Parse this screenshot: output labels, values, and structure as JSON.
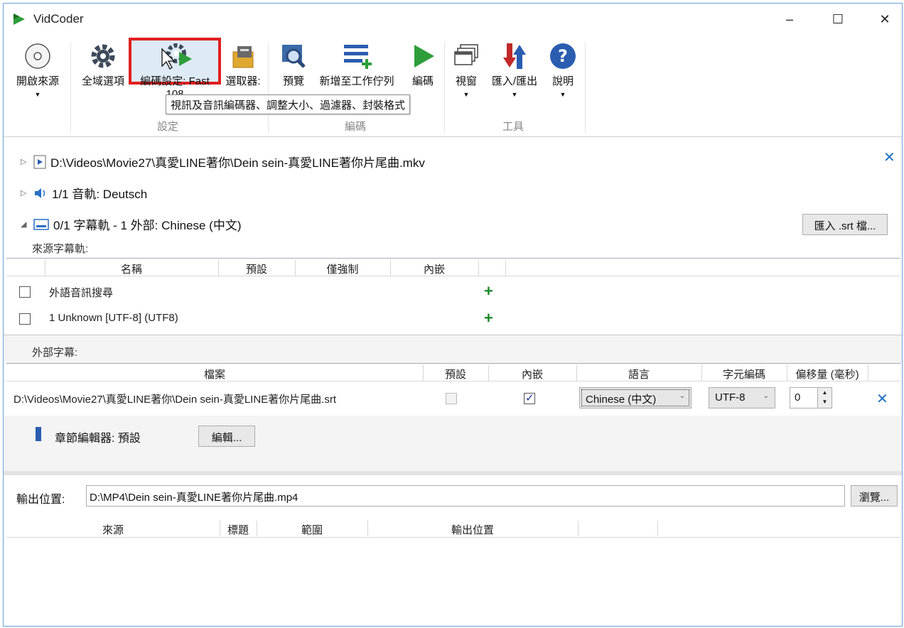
{
  "window": {
    "title": "VidCoder",
    "minimize": "–",
    "maximize": "☐",
    "close": "✕"
  },
  "ribbon": {
    "open_source": "開啟來源",
    "global_options": "全域選項",
    "encode_settings": "編碼設定: Fast",
    "encode_settings_line2": "108",
    "picker": "選取器:",
    "preview": "預覽",
    "add_queue": "新增至工作佇列",
    "encode": "編碼",
    "window": "視窗",
    "import_export": "匯入/匯出",
    "help": "說明",
    "group_settings": "設定",
    "group_encode": "編碼",
    "group_tools": "工具",
    "tooltip": "視訊及音訊編碼器、調整大小、過濾器、封裝格式",
    "dropdown_arrow": "▼"
  },
  "source": {
    "file_path": "D:\\Videos\\Movie27\\真愛LINE著你\\Dein sein-真愛LINE著你片尾曲.mkv",
    "audio": "1/1 音軌: Deutsch",
    "subtitles": "0/1 字幕軌 - 1 外部: Chinese (中文)",
    "import_srt": "匯入 .srt 檔...",
    "remove": "✕"
  },
  "source_subtitles": {
    "label": "來源字幕軌:",
    "headers": [
      "名稱",
      "預設",
      "僅強制",
      "內嵌"
    ],
    "rows": [
      {
        "name": "外語音訊搜尋",
        "add": "+"
      },
      {
        "name": "1 Unknown [UTF-8] (UTF8)",
        "add": "+"
      }
    ]
  },
  "external_subtitles": {
    "label": "外部字幕:",
    "headers": [
      "檔案",
      "預設",
      "內嵌",
      "語言",
      "字元編碼",
      "偏移量 (毫秒)"
    ],
    "rows": [
      {
        "file": "D:\\Videos\\Movie27\\真愛LINE著你\\Dein sein-真愛LINE著你片尾曲.srt",
        "default_checked": false,
        "burn_in_checked": true,
        "language": "Chinese (中文)",
        "charset": "UTF-8",
        "offset": "0",
        "remove": "✕"
      }
    ]
  },
  "chapters": {
    "label": "章節編輯器: 預設",
    "edit_button": "編輯..."
  },
  "output": {
    "label": "輸出位置:",
    "path": "D:\\MP4\\Dein sein-真愛LINE著你片尾曲.mp4",
    "browse": "瀏覽..."
  },
  "queue": {
    "headers": [
      "來源",
      "標題",
      "範圍",
      "輸出位置"
    ]
  },
  "colors": {
    "accent": "#1e6fc4",
    "highlight": "#e02020",
    "add_green": "#1a8a2a"
  }
}
